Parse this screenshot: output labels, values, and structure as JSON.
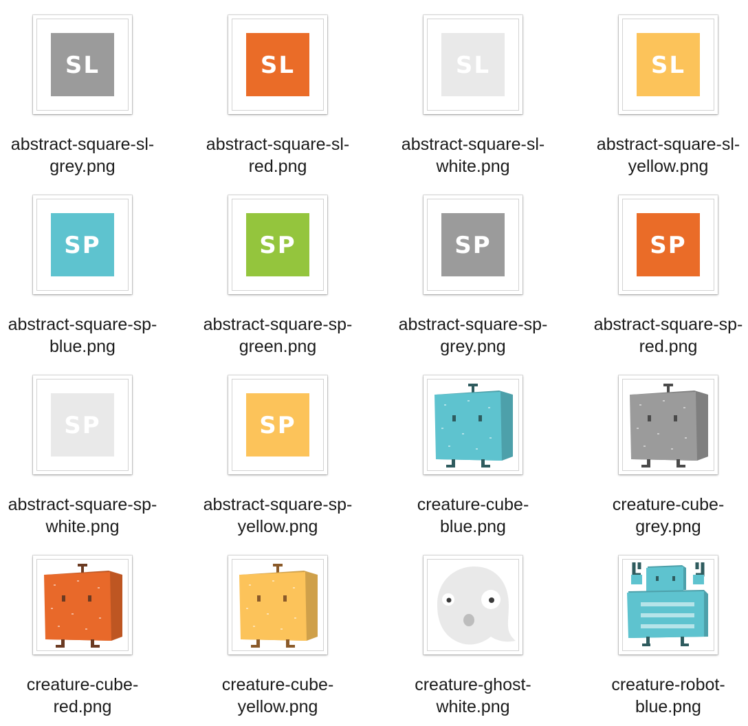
{
  "files": [
    {
      "line1": "abstract-square-sl-",
      "line2": "grey.png",
      "icon": "abstract-square-sl-grey-icon",
      "kind": "square",
      "text": "SL",
      "color": "#9b9b9b"
    },
    {
      "line1": "abstract-square-sl-",
      "line2": "red.png",
      "icon": "abstract-square-sl-red-icon",
      "kind": "square",
      "text": "SL",
      "color": "#ea6c28"
    },
    {
      "line1": "abstract-square-sl-",
      "line2": "white.png",
      "icon": "abstract-square-sl-white-icon",
      "kind": "square",
      "text": "SL",
      "color": "#e9e9e9"
    },
    {
      "line1": "abstract-square-sl-",
      "line2": "yellow.png",
      "icon": "abstract-square-sl-yellow-icon",
      "kind": "square",
      "text": "SL",
      "color": "#fcc35a"
    },
    {
      "line1": "abstract-square-sp-",
      "line2": "blue.png",
      "icon": "abstract-square-sp-blue-icon",
      "kind": "square",
      "text": "SP",
      "color": "#5ec3cf"
    },
    {
      "line1": "abstract-square-sp-",
      "line2": "green.png",
      "icon": "abstract-square-sp-green-icon",
      "kind": "square",
      "text": "SP",
      "color": "#94c53d"
    },
    {
      "line1": "abstract-square-sp-",
      "line2": "grey.png",
      "icon": "abstract-square-sp-grey-icon",
      "kind": "square",
      "text": "SP",
      "color": "#9b9b9b"
    },
    {
      "line1": "abstract-square-sp-",
      "line2": "red.png",
      "icon": "abstract-square-sp-red-icon",
      "kind": "square",
      "text": "SP",
      "color": "#ea6c28"
    },
    {
      "line1": "abstract-square-sp-",
      "line2": "white.png",
      "icon": "abstract-square-sp-white-icon",
      "kind": "square",
      "text": "SP",
      "color": "#e9e9e9"
    },
    {
      "line1": "abstract-square-sp-",
      "line2": "yellow.png",
      "icon": "abstract-square-sp-yellow-icon",
      "kind": "square",
      "text": "SP",
      "color": "#fcc35a"
    },
    {
      "line1": "creature-cube-",
      "line2": "blue.png",
      "icon": "creature-cube-blue-icon",
      "kind": "cube",
      "color": "#5ec3cf",
      "feet": "#2e5b5e"
    },
    {
      "line1": "creature-cube-",
      "line2": "grey.png",
      "icon": "creature-cube-grey-icon",
      "kind": "cube",
      "color": "#9b9b9b",
      "feet": "#4a4a4a"
    },
    {
      "line1": "creature-cube-",
      "line2": "red.png",
      "icon": "creature-cube-red-icon",
      "kind": "cube",
      "color": "#e8692a",
      "feet": "#6b3a22"
    },
    {
      "line1": "creature-cube-",
      "line2": "yellow.png",
      "icon": "creature-cube-yellow-icon",
      "kind": "cube",
      "color": "#fcc35a",
      "feet": "#8a5a2a"
    },
    {
      "line1": "creature-ghost-",
      "line2": "white.png",
      "icon": "creature-ghost-white-icon",
      "kind": "ghost",
      "color": "#e9e9e9"
    },
    {
      "line1": "creature-robot-",
      "line2": "blue.png",
      "icon": "creature-robot-blue-icon",
      "kind": "robot",
      "color": "#5ec3cf",
      "feet": "#2e5b5e"
    }
  ]
}
